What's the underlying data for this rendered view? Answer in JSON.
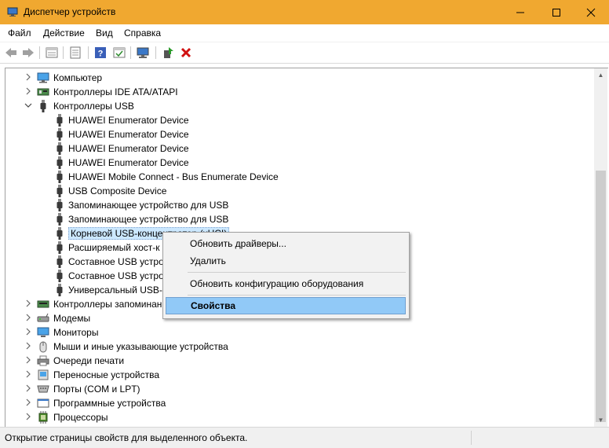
{
  "window": {
    "title": "Диспетчер устройств"
  },
  "menu": [
    "Файл",
    "Действие",
    "Вид",
    "Справка"
  ],
  "toolbar": {
    "icons": [
      "back-arrow-icon",
      "forward-arrow-icon",
      "properties-list-icon",
      "view-icon",
      "help-icon",
      "resources-icon",
      "monitor-scan-icon",
      "update-driver-icon",
      "delete-icon"
    ]
  },
  "tree": [
    {
      "label": "Компьютер",
      "expander": ">",
      "level": 0,
      "icon": "computer-icon"
    },
    {
      "label": "Контроллеры IDE ATA/ATAPI",
      "expander": ">",
      "level": 0,
      "icon": "ide-controller-icon"
    },
    {
      "label": "Контроллеры USB",
      "expander": "v",
      "level": 0,
      "icon": "usb-icon"
    },
    {
      "label": "HUAWEI Enumerator Device",
      "level": 1,
      "icon": "usb-icon"
    },
    {
      "label": "HUAWEI Enumerator Device",
      "level": 1,
      "icon": "usb-icon"
    },
    {
      "label": "HUAWEI Enumerator Device",
      "level": 1,
      "icon": "usb-icon"
    },
    {
      "label": "HUAWEI Enumerator Device",
      "level": 1,
      "icon": "usb-icon"
    },
    {
      "label": "HUAWEI Mobile Connect - Bus Enumerate Device",
      "level": 1,
      "icon": "usb-icon"
    },
    {
      "label": "USB Composite Device",
      "level": 1,
      "icon": "usb-icon"
    },
    {
      "label": "Запоминающее устройство для USB",
      "level": 1,
      "icon": "usb-icon"
    },
    {
      "label": "Запоминающее устройство для USB",
      "level": 1,
      "icon": "usb-icon"
    },
    {
      "label": "Корневой USB-концентратор (xHCI)",
      "level": 1,
      "icon": "usb-icon",
      "selected": true
    },
    {
      "label": "Расширяемый хост-к",
      "level": 1,
      "icon": "usb-icon"
    },
    {
      "label": "Составное USB устрой",
      "level": 1,
      "icon": "usb-icon"
    },
    {
      "label": "Составное USB устрой",
      "level": 1,
      "icon": "usb-icon"
    },
    {
      "label": "Универсальный USB-к",
      "level": 1,
      "icon": "usb-icon"
    },
    {
      "label": "Контроллеры запоминан",
      "expander": ">",
      "level": 0,
      "icon": "storage-controller-icon"
    },
    {
      "label": "Модемы",
      "expander": ">",
      "level": 0,
      "icon": "modem-icon"
    },
    {
      "label": "Мониторы",
      "expander": ">",
      "level": 0,
      "icon": "monitor-icon"
    },
    {
      "label": "Мыши и иные указывающие устройства",
      "expander": ">",
      "level": 0,
      "icon": "mouse-icon"
    },
    {
      "label": "Очереди печати",
      "expander": ">",
      "level": 0,
      "icon": "printer-icon"
    },
    {
      "label": "Переносные устройства",
      "expander": ">",
      "level": 0,
      "icon": "portable-device-icon"
    },
    {
      "label": "Порты (COM и LPT)",
      "expander": ">",
      "level": 0,
      "icon": "port-icon"
    },
    {
      "label": "Программные устройства",
      "expander": ">",
      "level": 0,
      "icon": "software-device-icon"
    },
    {
      "label": "Процессоры",
      "expander": ">",
      "level": 0,
      "icon": "processor-icon"
    }
  ],
  "context_menu": {
    "update": "Обновить драйверы...",
    "remove": "Удалить",
    "scan": "Обновить конфигурацию оборудования",
    "properties": "Свойства"
  },
  "status": {
    "text": "Открытие страницы свойств для выделенного объекта."
  },
  "colors": {
    "titlebar": "#f0a830",
    "menu_highlight": "#91c9f7",
    "selection": "#cce8ff"
  }
}
